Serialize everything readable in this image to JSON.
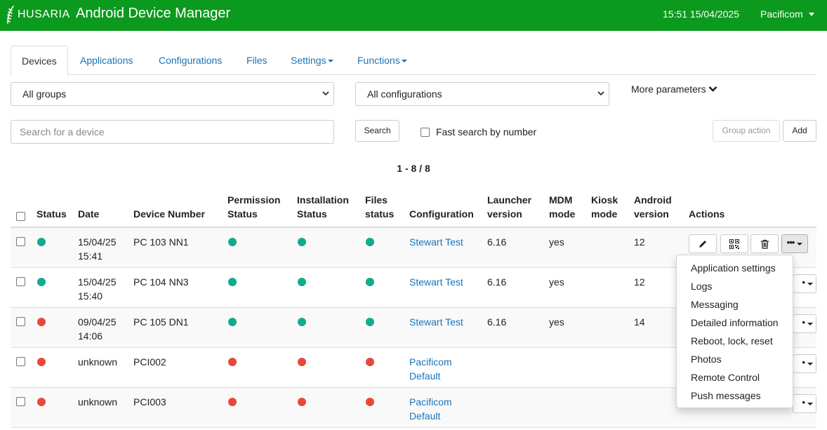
{
  "header": {
    "logo_text": "HUSARIA",
    "title": "Android Device Manager",
    "datetime": "15:51 15/04/2025",
    "user": "Pacificom",
    "bg_color": "#0b9a1d"
  },
  "tabs": [
    {
      "label": "Devices",
      "active": true
    },
    {
      "label": "Applications"
    },
    {
      "label": "Configurations"
    },
    {
      "label": "Files"
    },
    {
      "label": "Settings",
      "dropdown": true
    },
    {
      "label": "Functions",
      "dropdown": true
    }
  ],
  "filters": {
    "group_select": "All groups",
    "config_select": "All configurations",
    "more_parameters": "More parameters",
    "search_placeholder": "Search for a device",
    "search_button": "Search",
    "fast_search_label": "Fast search by number",
    "group_action_button": "Group action",
    "add_button": "Add"
  },
  "pager": "1 - 8 / 8",
  "table": {
    "columns": {
      "status": "Status",
      "date": "Date",
      "device_number": "Device Number",
      "permission_1": "Permission",
      "permission_2": "Status",
      "installation_1": "Installation",
      "installation_2": "Status",
      "files_1": "Files",
      "files_2": "status",
      "configuration": "Configuration",
      "launcher_1": "Launcher",
      "launcher_2": "version",
      "mdm_1": "MDM",
      "mdm_2": "mode",
      "kiosk_1": "Kiosk",
      "kiosk_2": "mode",
      "android_1": "Android",
      "android_2": "version",
      "actions": "Actions"
    },
    "rows": [
      {
        "status": "green",
        "date_1": "15/04/25",
        "date_2": "15:41",
        "device": "PC 103 NN1",
        "permission": "green",
        "installation": "green",
        "files": "green",
        "config_1": "Stewart Test",
        "config_2": "",
        "launcher": "6.16",
        "mdm": "yes",
        "kiosk": "",
        "android": "12"
      },
      {
        "status": "green",
        "date_1": "15/04/25",
        "date_2": "15:40",
        "device": "PC 104 NN3",
        "permission": "green",
        "installation": "green",
        "files": "green",
        "config_1": "Stewart Test",
        "config_2": "",
        "launcher": "6.16",
        "mdm": "yes",
        "kiosk": "",
        "android": "12"
      },
      {
        "status": "red",
        "date_1": "09/04/25",
        "date_2": "14:06",
        "device": "PC 105 DN1",
        "permission": "green",
        "installation": "green",
        "files": "green",
        "config_1": "Stewart Test",
        "config_2": "",
        "launcher": "6.16",
        "mdm": "yes",
        "kiosk": "",
        "android": "14"
      },
      {
        "status": "red",
        "date_1": "unknown",
        "date_2": "",
        "device": "PCI002",
        "permission": "red",
        "installation": "red",
        "files": "red",
        "config_1": "Pacificom",
        "config_2": "Default",
        "launcher": "",
        "mdm": "",
        "kiosk": "",
        "android": ""
      },
      {
        "status": "red",
        "date_1": "unknown",
        "date_2": "",
        "device": "PCI003",
        "permission": "red",
        "installation": "red",
        "files": "red",
        "config_1": "Pacificom",
        "config_2": "Default",
        "launcher": "",
        "mdm": "",
        "kiosk": "",
        "android": ""
      }
    ]
  },
  "dropdown_menu": [
    "Application settings",
    "Logs",
    "Messaging",
    "Detailed information",
    "Reboot, lock, reset",
    "Photos",
    "Remote Control",
    "Push messages"
  ]
}
